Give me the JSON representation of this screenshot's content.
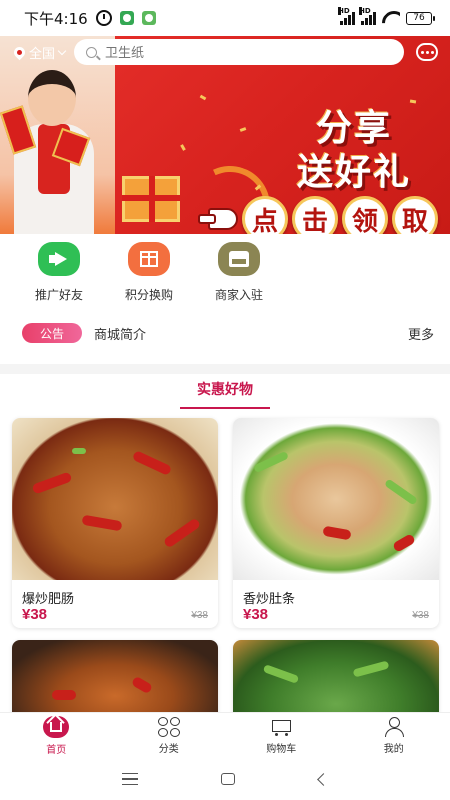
{
  "status_bar": {
    "time": "下午4:16",
    "signal1_label": "HD",
    "signal2_label": "HD",
    "battery": "76"
  },
  "header": {
    "location": "全国",
    "search_placeholder": "卫生纸"
  },
  "banner": {
    "title_line1": "分享",
    "title_line2": "送好礼",
    "cta_chars": [
      "点",
      "击",
      "领",
      "取"
    ]
  },
  "entries": [
    {
      "label": "推广好友",
      "icon": "megaphone-icon",
      "color": "#2fbf55"
    },
    {
      "label": "积分换购",
      "icon": "gift-icon",
      "color": "#f36f3f"
    },
    {
      "label": "商家入驻",
      "icon": "store-icon",
      "color": "#8b8553"
    }
  ],
  "notice": {
    "badge": "公告",
    "text": "商城简介",
    "more": "更多"
  },
  "section": {
    "title": "实惠好物"
  },
  "products": [
    {
      "name": "爆炒肥肠",
      "price": "¥38",
      "old_price": "¥38"
    },
    {
      "name": "香炒肚条",
      "price": "¥38",
      "old_price": "¥38"
    },
    {
      "name": "",
      "price": "",
      "old_price": ""
    },
    {
      "name": "",
      "price": "",
      "old_price": ""
    }
  ],
  "bottom_nav": [
    {
      "label": "首页",
      "icon": "home-icon",
      "active": true
    },
    {
      "label": "分类",
      "icon": "category-icon",
      "active": false
    },
    {
      "label": "购物车",
      "icon": "cart-icon",
      "active": false
    },
    {
      "label": "我的",
      "icon": "user-icon",
      "active": false
    }
  ],
  "colors": {
    "accent": "#c8174d",
    "banner_red": "#d8231f"
  }
}
